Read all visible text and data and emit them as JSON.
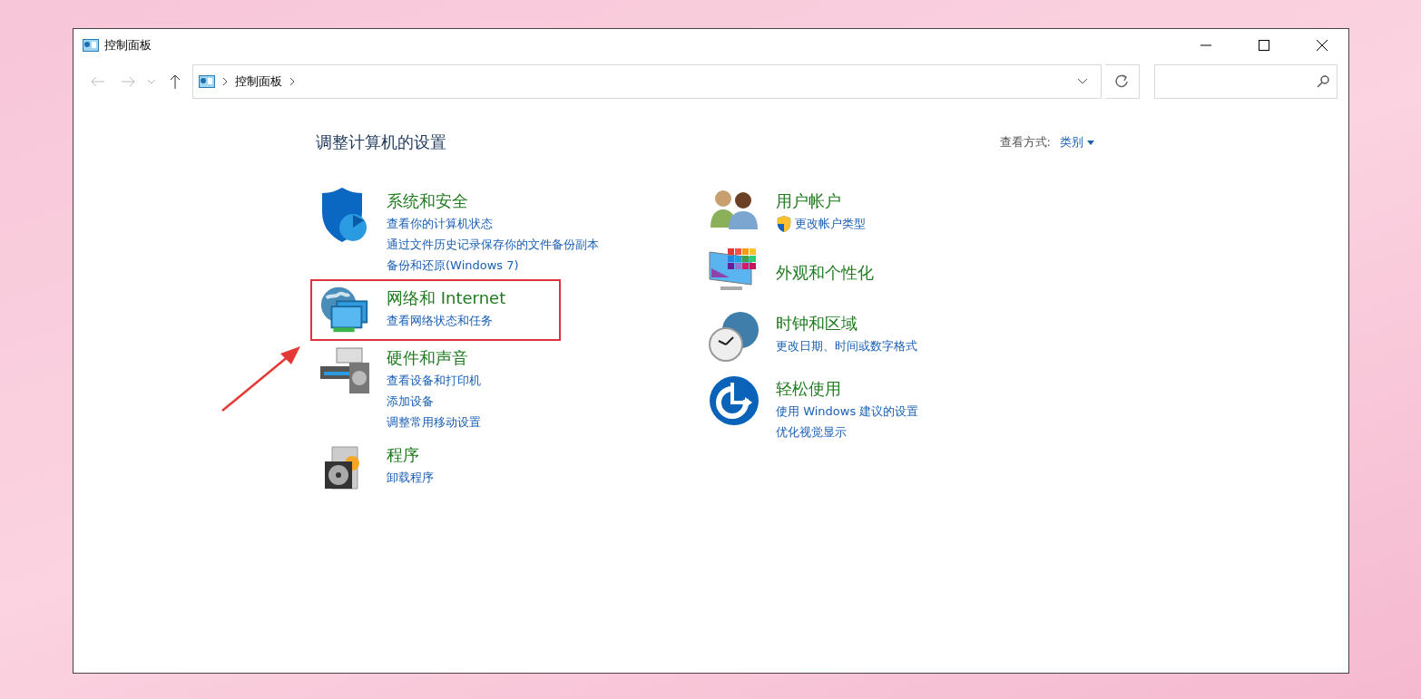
{
  "window": {
    "title": "控制面板"
  },
  "address_bar": {
    "path": [
      "控制面板"
    ]
  },
  "heading": "调整计算机的设置",
  "view_by": {
    "label": "查看方式:",
    "value": "类别"
  },
  "columns": [
    {
      "categories": [
        {
          "title": "系统和安全",
          "highlighted": false,
          "links": [
            {
              "text": "查看你的计算机状态",
              "admin": false
            },
            {
              "text": "通过文件历史记录保存你的文件备份副本",
              "admin": false
            },
            {
              "text": "备份和还原(Windows 7)",
              "admin": false
            }
          ]
        },
        {
          "title": "网络和 Internet",
          "highlighted": true,
          "links": [
            {
              "text": "查看网络状态和任务",
              "admin": false
            }
          ]
        },
        {
          "title": "硬件和声音",
          "highlighted": false,
          "links": [
            {
              "text": "查看设备和打印机",
              "admin": false
            },
            {
              "text": "添加设备",
              "admin": false
            },
            {
              "text": "调整常用移动设置",
              "admin": false
            }
          ]
        },
        {
          "title": "程序",
          "highlighted": false,
          "links": [
            {
              "text": "卸载程序",
              "admin": false
            }
          ]
        }
      ]
    },
    {
      "categories": [
        {
          "title": "用户帐户",
          "highlighted": false,
          "links": [
            {
              "text": "更改帐户类型",
              "admin": true
            }
          ]
        },
        {
          "title": "外观和个性化",
          "highlighted": false
        },
        {
          "title": "时钟和区域",
          "highlighted": false,
          "links": [
            {
              "text": "更改日期、时间或数字格式",
              "admin": false
            }
          ]
        },
        {
          "title": "轻松使用",
          "highlighted": false,
          "links": [
            {
              "text": "使用 Windows 建议的设置",
              "admin": false
            },
            {
              "text": "优化视觉显示",
              "admin": false
            }
          ]
        }
      ]
    }
  ]
}
